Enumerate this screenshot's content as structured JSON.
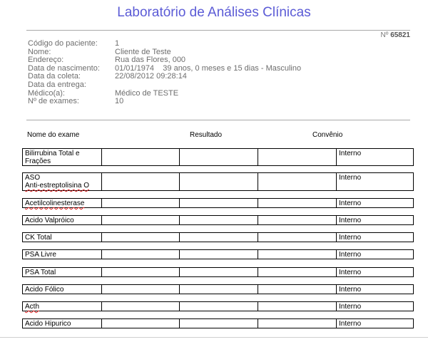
{
  "header": {
    "title": "Laboratório de Análises Clínicas",
    "order_prefix": "Nº",
    "order_number": "65821"
  },
  "patient": {
    "fields": [
      {
        "label": "Código do paciente:",
        "value": "1"
      },
      {
        "label": "Nome:",
        "value": "Cliente de Teste"
      },
      {
        "label": "Endereço:",
        "value": "Rua das Flores, 000"
      },
      {
        "label": "Data de nascimento:",
        "value": "01/01/1974    39 anos, 0 meses e 15 dias - Masculino"
      },
      {
        "label": "Data da coleta:",
        "value": "22/08/2012 09:28:14"
      },
      {
        "label": "Data da entrega:",
        "value": ""
      },
      {
        "label": "Médico(a):",
        "value": "Médico de TESTE"
      },
      {
        "label": "Nº de exames:",
        "value": "10"
      }
    ]
  },
  "table": {
    "headers": {
      "exam": "Nome do exame",
      "result": "Resultado",
      "insurance": "Convênio"
    },
    "rows": [
      {
        "name": [
          "Bilirrubina Total e",
          "Frações"
        ],
        "insurance": "Interno"
      },
      {
        "name": [
          "ASO",
          "Anti-estreptolisina O"
        ],
        "insurance": "Interno"
      },
      {
        "name": [
          "Acetilcolinesterase"
        ],
        "insurance": "Interno"
      },
      {
        "name": [
          "Acido Valpróico"
        ],
        "insurance": "Interno"
      },
      {
        "name": [
          "CK Total"
        ],
        "insurance": "Interno"
      },
      {
        "name": [
          "PSA Livre"
        ],
        "insurance": "Interno"
      },
      {
        "name": [
          "PSA Total"
        ],
        "insurance": "Interno"
      },
      {
        "name": [
          "Acido Fólico"
        ],
        "insurance": "Interno"
      },
      {
        "name": [
          "Acth"
        ],
        "insurance": "Interno"
      },
      {
        "name": [
          "Acido Hipurico"
        ],
        "insurance": "Interno"
      }
    ]
  }
}
